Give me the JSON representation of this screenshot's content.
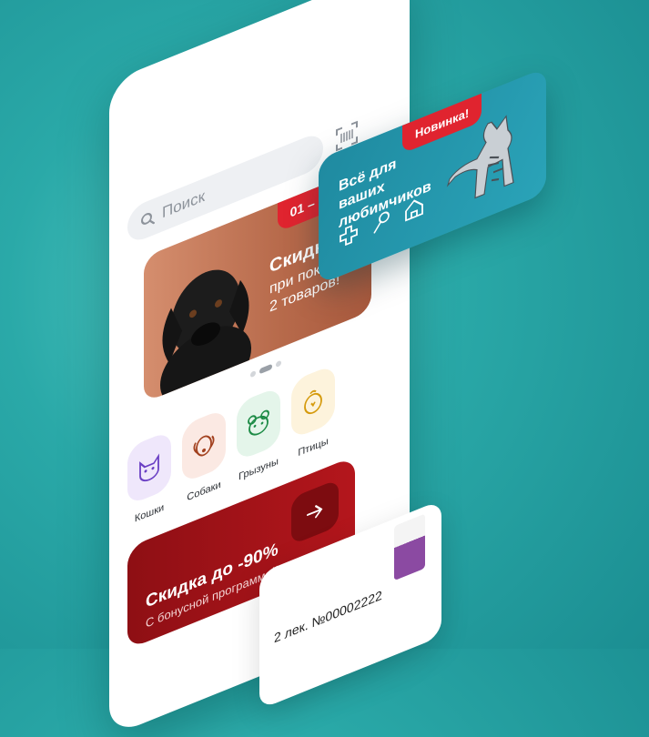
{
  "search": {
    "placeholder": "Поиск"
  },
  "main_banner": {
    "date": "01 – 23 апр",
    "title": "Скидки",
    "subtitle": "при покупке от 2 товаров!"
  },
  "categories": [
    {
      "label": "Кошки",
      "color": "#efe7fb",
      "icon": "cat-icon"
    },
    {
      "label": "Собаки",
      "color": "#fbe9e3",
      "icon": "dog-icon"
    },
    {
      "label": "Грызуны",
      "color": "#e4f5ea",
      "icon": "rodent-icon"
    },
    {
      "label": "Птицы",
      "color": "#fdf3dc",
      "icon": "bird-icon"
    }
  ],
  "promo": {
    "title": "Скидка до -90%",
    "subtitle": "С бонусной программой"
  },
  "order_card": {
    "text": "2 лек. №00002222"
  },
  "side_banner": {
    "tag": "Новинка!",
    "title": "Всё для ваших любимчиков"
  },
  "colors": {
    "brand_red": "#e0242f",
    "promo_red": "#a8151a",
    "teal": "#2aa3b8"
  }
}
